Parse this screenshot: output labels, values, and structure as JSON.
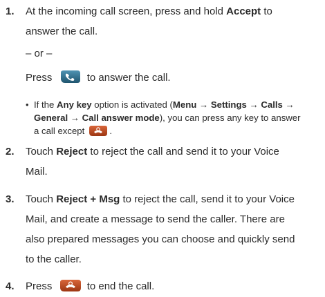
{
  "steps": [
    {
      "number": "1.",
      "lines": [
        {
          "parts": [
            "At the incoming call screen, press and hold ",
            "Accept",
            " to"
          ]
        },
        {
          "parts": [
            "answer the call."
          ]
        }
      ],
      "or_text": "– or –",
      "press_before": "Press",
      "press_after": "to answer the call.",
      "bullet": {
        "dot": "•",
        "line1": [
          "If the ",
          "Any key",
          " option is activated (",
          "Menu → Settings → Calls →"
        ],
        "line2": [
          "General → Call answer mode",
          "), you can press any key to answer"
        ],
        "line3_before": "a call except",
        "line3_after": "."
      }
    },
    {
      "number": "2.",
      "lines": [
        {
          "parts": [
            "Touch ",
            "Reject",
            " to reject the call and send it to your Voice"
          ]
        },
        {
          "parts": [
            "Mail."
          ]
        }
      ]
    },
    {
      "number": "3.",
      "lines": [
        {
          "parts": [
            "Touch ",
            "Reject + Msg",
            " to reject the call, send it to your Voice"
          ]
        },
        {
          "parts": [
            "Mail, and create a message to send the caller. There are"
          ]
        },
        {
          "parts": [
            "also prepared messages you can choose and quickly send"
          ]
        },
        {
          "parts": [
            "to the caller."
          ]
        }
      ]
    },
    {
      "number": "4.",
      "press_before": "Press",
      "press_after": "to end the call."
    }
  ],
  "icons": {
    "send_key": "phone-send-key-icon",
    "end_key": "phone-end-key-icon",
    "colors": {
      "send_key_fill": "#2f6f8f",
      "end_key_fill": "#b5451b"
    }
  }
}
